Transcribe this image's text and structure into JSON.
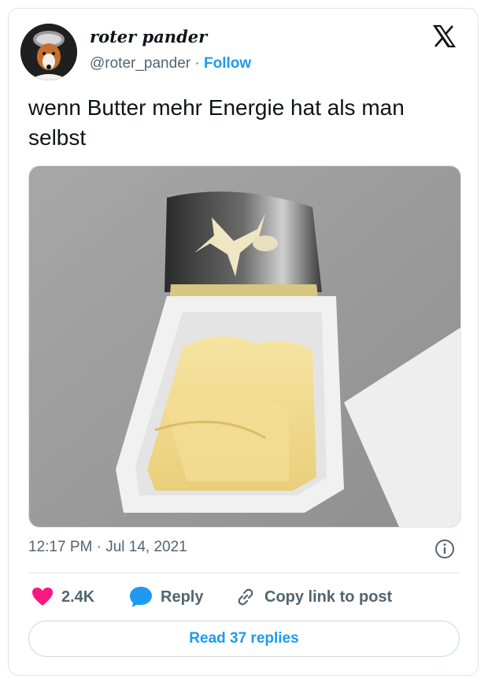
{
  "author": {
    "display_name": "roter pander",
    "handle": "@roter_pander",
    "separator": " · ",
    "follow_label": "Follow"
  },
  "tweet": {
    "text": "wenn Butter mehr Energie hat als man selbst",
    "timestamp": "12:17 PM · Jul 14, 2021"
  },
  "actions": {
    "like_count": "2.4K",
    "reply_label": "Reply",
    "copy_link_label": "Copy link to post"
  },
  "footer": {
    "read_replies_label": "Read 37 replies"
  },
  "icons": {
    "like": "heart-icon",
    "reply": "speech-bubble-icon",
    "copy_link": "link-icon",
    "info": "info-icon",
    "brand": "x-logo-icon"
  },
  "colors": {
    "accent": "#1d9bf0",
    "like": "#f91880",
    "muted_text": "#536471",
    "primary_text": "#0f1419"
  }
}
